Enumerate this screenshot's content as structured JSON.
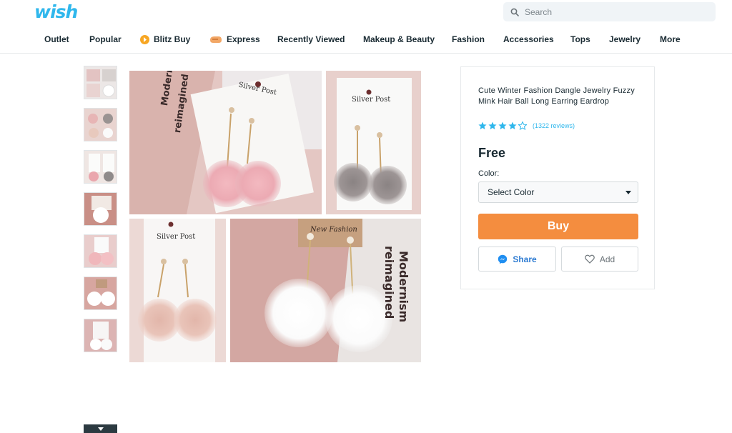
{
  "brand": {
    "logo_text": "wish",
    "color": "#2fb7ec"
  },
  "search": {
    "placeholder": "Search",
    "icon": "search-icon"
  },
  "nav": {
    "items": [
      {
        "label": "Outlet"
      },
      {
        "label": "Popular"
      },
      {
        "label": "Blitz Buy",
        "icon": "blitz-buy-icon"
      },
      {
        "label": "Express",
        "icon": "express-icon"
      },
      {
        "label": "Recently Viewed"
      },
      {
        "label": "Makeup & Beauty"
      },
      {
        "label": "Fashion"
      },
      {
        "label": "Accessories"
      },
      {
        "label": "Tops"
      },
      {
        "label": "Jewelry"
      },
      {
        "label": "More"
      }
    ]
  },
  "gallery": {
    "thumbnail_count": 7,
    "scroll_icon": "chevron-down-icon",
    "card_brand_1": "Silver Post",
    "card_brand_2": "Silver Post",
    "card_brand_3": "Silver Post",
    "card_brand_4": "New Fashion",
    "magazine_text_1": "Modernism",
    "magazine_text_2": "reimagined"
  },
  "product": {
    "title": "Cute Winter Fashion Dangle Jewelry Fuzzy Mink Hair Ball Long Earring Eardrop",
    "rating": 4,
    "rating_max": 5,
    "reviews": "(1322 reviews)",
    "price": "Free",
    "color_label": "Color:",
    "color_select": "Select Color",
    "buy_label": "Buy",
    "share_label": "Share",
    "add_label": "Add",
    "accent_color": "#f48d3f",
    "link_color": "#2fb7ec"
  }
}
